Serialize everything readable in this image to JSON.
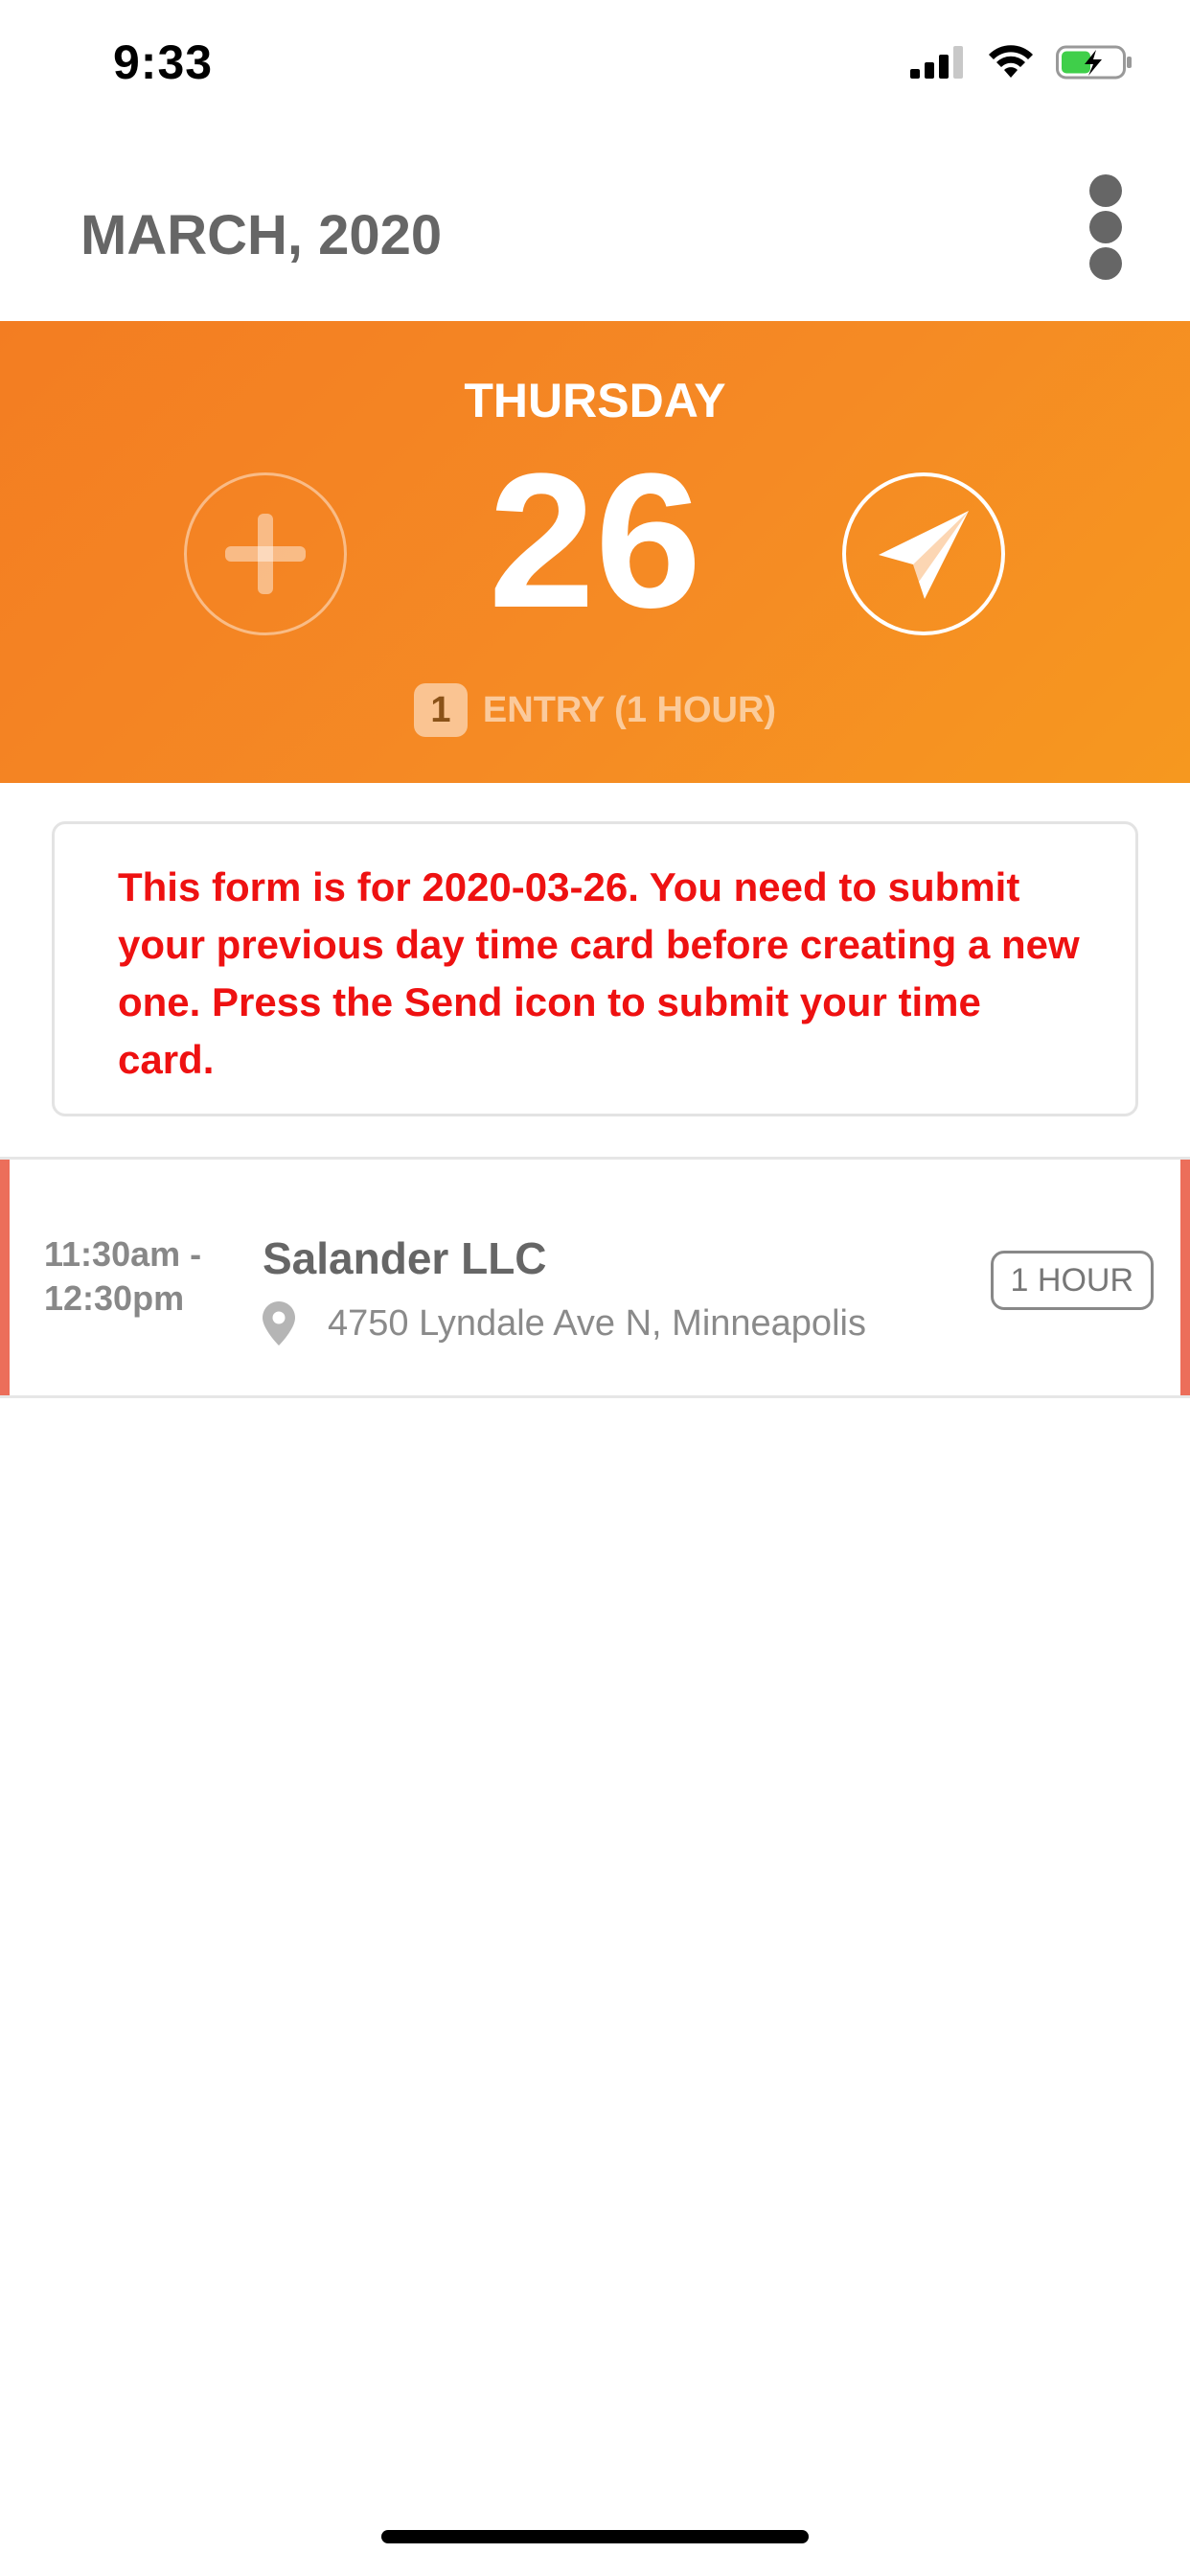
{
  "status_bar": {
    "time": "9:33",
    "icons": [
      "cellular-signal-icon",
      "wifi-icon",
      "battery-charging-icon"
    ],
    "battery_color": "#3fcf4a"
  },
  "header": {
    "month_title": "MARCH, 2020",
    "menu_icon": "more-vertical-icon"
  },
  "day_banner": {
    "weekday": "THURSDAY",
    "day_number": "26",
    "entry_count": "1",
    "entry_summary": "ENTRY (1 HOUR)",
    "add_icon": "plus-icon",
    "send_icon": "paper-plane-icon",
    "background_color": "#f58a24"
  },
  "warning": {
    "message": "This form is for 2020-03-26. You need to submit your previous day time card before creating a new one. Press the Send icon to submit your time card.",
    "color": "#ee1111"
  },
  "entries": [
    {
      "time_range": "11:30am - 12:30pm",
      "company": "Salander LLC",
      "address": "4750 Lyndale Ave N, Minneapolis",
      "duration": "1 HOUR",
      "location_icon": "map-pin-icon",
      "accent_color": "#ec6e5a"
    }
  ]
}
